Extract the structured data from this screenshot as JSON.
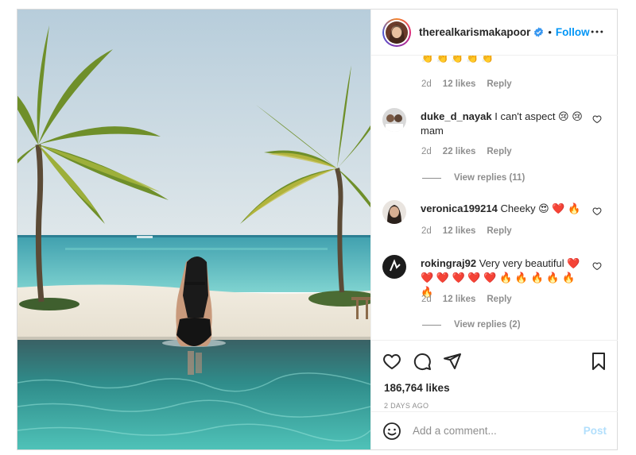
{
  "post": {
    "username": "therealkarismakapoor",
    "verified": true,
    "separator": "•",
    "follow_label": "Follow",
    "more_icon": "more-horizontal-icon",
    "image_alt_semantic": "beach-infinity-pool-photo"
  },
  "comments": {
    "previous": {
      "emoji": "👏👏👏👏👏",
      "age": "2d",
      "likes": "12 likes",
      "reply": "Reply"
    },
    "items": [
      {
        "user": "duke_d_nayak",
        "text": "I can't aspect 😢 😢 mam",
        "age": "2d",
        "likes": "22 likes",
        "reply": "Reply",
        "view_replies": "View replies (11)"
      },
      {
        "user": "veronica199214",
        "text": "Cheeky 😍 ❤️ 🔥",
        "age": "2d",
        "likes": "12 likes",
        "reply": "Reply"
      },
      {
        "user": "rokingraj92",
        "text": "Very very beautiful ❤️ ❤️ ❤️ ❤️ ❤️ ❤️ 🔥 🔥 🔥 🔥 🔥 🔥",
        "age": "2d",
        "likes": "12 likes",
        "reply": "Reply",
        "view_replies": "View replies (2)"
      }
    ]
  },
  "actions": {
    "like_icon": "heart-icon",
    "comment_icon": "comment-icon",
    "share_icon": "send-icon",
    "save_icon": "bookmark-icon"
  },
  "likes_count": "186,764 likes",
  "date": "2 DAYS AGO",
  "add_comment": {
    "placeholder": "Add a comment...",
    "post_label": "Post",
    "emoji_icon": "smiley-icon"
  },
  "colors": {
    "accent": "#0095f6",
    "muted": "#8e8e8e",
    "post_disabled": "#b2dffc",
    "border": "#dbdbdb"
  }
}
